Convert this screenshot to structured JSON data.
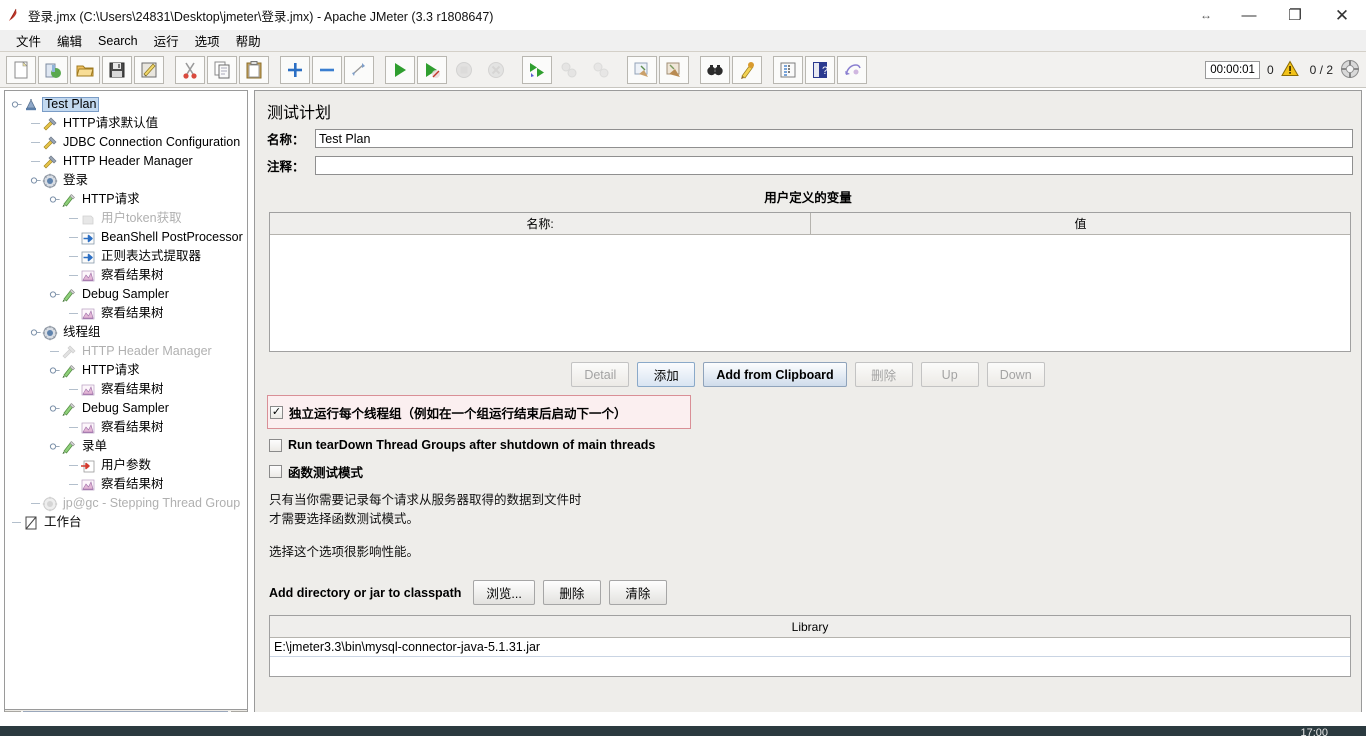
{
  "window": {
    "title": "登录.jmx (C:\\Users\\24831\\Desktop\\jmeter\\登录.jmx) - Apache JMeter (3.3 r1808647)",
    "app_icon": "jmeter-feather-icon",
    "controls": {
      "resize": "↔",
      "minimize": "—",
      "restore": "❐",
      "close": "✕"
    }
  },
  "menubar": {
    "items": [
      {
        "label": "文件",
        "name": "menu-file"
      },
      {
        "label": "编辑",
        "name": "menu-edit"
      },
      {
        "label": "Search",
        "name": "menu-search"
      },
      {
        "label": "运行",
        "name": "menu-run"
      },
      {
        "label": "选项",
        "name": "menu-options"
      },
      {
        "label": "帮助",
        "name": "menu-help"
      }
    ]
  },
  "toolbar": {
    "buttons": [
      {
        "name": "new-icon",
        "enabled": true
      },
      {
        "name": "templates-icon",
        "enabled": true
      },
      {
        "name": "open-icon",
        "enabled": true
      },
      {
        "name": "save-icon",
        "enabled": true
      },
      {
        "name": "save-as-icon",
        "enabled": true
      },
      {
        "name": "cut-icon",
        "enabled": true
      },
      {
        "name": "copy-icon",
        "enabled": true
      },
      {
        "name": "paste-icon",
        "enabled": true
      },
      {
        "name": "expand-all-icon",
        "enabled": true
      },
      {
        "name": "collapse-all-icon",
        "enabled": true
      },
      {
        "name": "toggle-icon",
        "enabled": true
      },
      {
        "name": "start-icon",
        "enabled": true
      },
      {
        "name": "start-no-pauses-icon",
        "enabled": true
      },
      {
        "name": "stop-icon",
        "enabled": false
      },
      {
        "name": "shutdown-icon",
        "enabled": false
      },
      {
        "name": "start-remote-all-icon",
        "enabled": true
      },
      {
        "name": "stop-remote-all-icon",
        "enabled": false
      },
      {
        "name": "shutdown-remote-all-icon",
        "enabled": false
      },
      {
        "name": "clear-icon",
        "enabled": true
      },
      {
        "name": "clear-all-icon",
        "enabled": true
      },
      {
        "name": "search-icon",
        "enabled": true
      },
      {
        "name": "search-reset-icon",
        "enabled": true
      },
      {
        "name": "function-helper-icon",
        "enabled": true
      },
      {
        "name": "help-icon",
        "enabled": true
      },
      {
        "name": "undo-icon",
        "enabled": true
      }
    ],
    "status": {
      "timer": "00:00:01",
      "error_count": "0",
      "warning_icon": "warning-triangle-icon",
      "threads": "0 / 2",
      "connector_icon": "remote-connection-icon"
    }
  },
  "tree": {
    "nodes": [
      {
        "label": "Test Plan",
        "icon": "test-plan-icon",
        "depth": 0,
        "handle": "expanded",
        "selected": true,
        "disabled": false
      },
      {
        "label": "HTTP请求默认值",
        "icon": "config-element-icon",
        "depth": 1,
        "handle": "leaf",
        "selected": false,
        "disabled": false
      },
      {
        "label": "JDBC Connection Configuration",
        "icon": "config-element-icon",
        "depth": 1,
        "handle": "leaf",
        "selected": false,
        "disabled": false
      },
      {
        "label": "HTTP Header Manager",
        "icon": "config-element-icon",
        "depth": 1,
        "handle": "leaf",
        "selected": false,
        "disabled": false
      },
      {
        "label": "登录",
        "icon": "thread-group-icon",
        "depth": 1,
        "handle": "expanded",
        "selected": false,
        "disabled": false
      },
      {
        "label": "HTTP请求",
        "icon": "sampler-icon",
        "depth": 2,
        "handle": "expanded",
        "selected": false,
        "disabled": false
      },
      {
        "label": "用户token获取",
        "icon": "disabled-sampler-icon",
        "depth": 3,
        "handle": "leaf",
        "selected": false,
        "disabled": true
      },
      {
        "label": "BeanShell PostProcessor",
        "icon": "post-processor-icon",
        "depth": 3,
        "handle": "leaf",
        "selected": false,
        "disabled": false
      },
      {
        "label": "正则表达式提取器",
        "icon": "post-processor-icon",
        "depth": 3,
        "handle": "leaf",
        "selected": false,
        "disabled": false
      },
      {
        "label": "察看结果树",
        "icon": "listener-icon",
        "depth": 3,
        "handle": "leaf",
        "selected": false,
        "disabled": false
      },
      {
        "label": "Debug Sampler",
        "icon": "sampler-icon",
        "depth": 2,
        "handle": "expanded",
        "selected": false,
        "disabled": false
      },
      {
        "label": "察看结果树",
        "icon": "listener-icon",
        "depth": 3,
        "handle": "leaf",
        "selected": false,
        "disabled": false
      },
      {
        "label": "线程组",
        "icon": "thread-group-icon",
        "depth": 1,
        "handle": "expanded",
        "selected": false,
        "disabled": false
      },
      {
        "label": "HTTP Header Manager",
        "icon": "disabled-config-icon",
        "depth": 2,
        "handle": "leaf",
        "selected": false,
        "disabled": true
      },
      {
        "label": "HTTP请求",
        "icon": "sampler-icon",
        "depth": 2,
        "handle": "expanded",
        "selected": false,
        "disabled": false
      },
      {
        "label": "察看结果树",
        "icon": "listener-icon",
        "depth": 3,
        "handle": "leaf",
        "selected": false,
        "disabled": false
      },
      {
        "label": "Debug Sampler",
        "icon": "sampler-icon",
        "depth": 2,
        "handle": "expanded",
        "selected": false,
        "disabled": false
      },
      {
        "label": "察看结果树",
        "icon": "listener-icon",
        "depth": 3,
        "handle": "leaf",
        "selected": false,
        "disabled": false
      },
      {
        "label": "录单",
        "icon": "sampler-icon",
        "depth": 2,
        "handle": "expanded",
        "selected": false,
        "disabled": false
      },
      {
        "label": "用户参数",
        "icon": "user-parameters-icon",
        "depth": 3,
        "handle": "leaf",
        "selected": false,
        "disabled": false
      },
      {
        "label": "察看结果树",
        "icon": "listener-icon",
        "depth": 3,
        "handle": "leaf",
        "selected": false,
        "disabled": false
      },
      {
        "label": "jp@gc - Stepping Thread Group",
        "icon": "disabled-thread-group-icon",
        "depth": 1,
        "handle": "leaf",
        "selected": false,
        "disabled": true
      },
      {
        "label": "工作台",
        "icon": "workbench-icon",
        "depth": 0,
        "handle": "leaf",
        "selected": false,
        "disabled": false
      }
    ],
    "scrollbar": {
      "left_arrow": "◀",
      "right_arrow": "▶"
    }
  },
  "panel": {
    "title": "测试计划",
    "name_label": "名称：",
    "name_value": "Test Plan",
    "comment_label": "注释：",
    "comment_value": "",
    "variables": {
      "section_title": "用户定义的变量",
      "columns": [
        "名称:",
        "值"
      ],
      "rows": []
    },
    "variable_buttons": [
      {
        "label": "Detail",
        "name": "detail-button",
        "state": "disabled"
      },
      {
        "label": "添加",
        "name": "add-button",
        "state": "focused"
      },
      {
        "label": "Add from Clipboard",
        "name": "add-from-clipboard-button",
        "state": "primary"
      },
      {
        "label": "删除",
        "name": "delete-button",
        "state": "disabled"
      },
      {
        "label": "Up",
        "name": "up-button",
        "state": "disabled"
      },
      {
        "label": "Down",
        "name": "down-button",
        "state": "disabled"
      }
    ],
    "checkboxes": [
      {
        "label": "独立运行每个线程组（例如在一个组运行结束后启动下一个）",
        "checked": true,
        "highlighted": true,
        "bold": true,
        "name": "serialize-thread-groups-checkbox"
      },
      {
        "label": "Run tearDown Thread Groups after shutdown of main threads",
        "checked": false,
        "highlighted": false,
        "bold": true,
        "name": "run-teardown-checkbox"
      },
      {
        "label": "函数测试模式",
        "checked": false,
        "highlighted": false,
        "bold": true,
        "name": "functional-test-mode-checkbox"
      }
    ],
    "description": [
      "只有当你需要记录每个请求从服务器取得的数据到文件时",
      "才需要选择函数测试模式。",
      "",
      "选择这个选项很影响性能。"
    ],
    "classpath": {
      "label": "Add directory or jar to classpath",
      "buttons": [
        {
          "label": "浏览...",
          "name": "browse-button"
        },
        {
          "label": "删除",
          "name": "classpath-delete-button"
        },
        {
          "label": "清除",
          "name": "classpath-clear-button"
        }
      ],
      "column": "Library",
      "rows": [
        "E:\\jmeter3.3\\bin\\mysql-connector-java-5.1.31.jar"
      ]
    }
  },
  "taskbar": {
    "clock": "17:00"
  },
  "colors": {
    "accent_selection": "#c3d9f0",
    "highlight_box": "#d98f96",
    "panel_bg": "#eeedea",
    "taskbar_bg": "#2b3a3f",
    "warning": "#f0c419"
  }
}
